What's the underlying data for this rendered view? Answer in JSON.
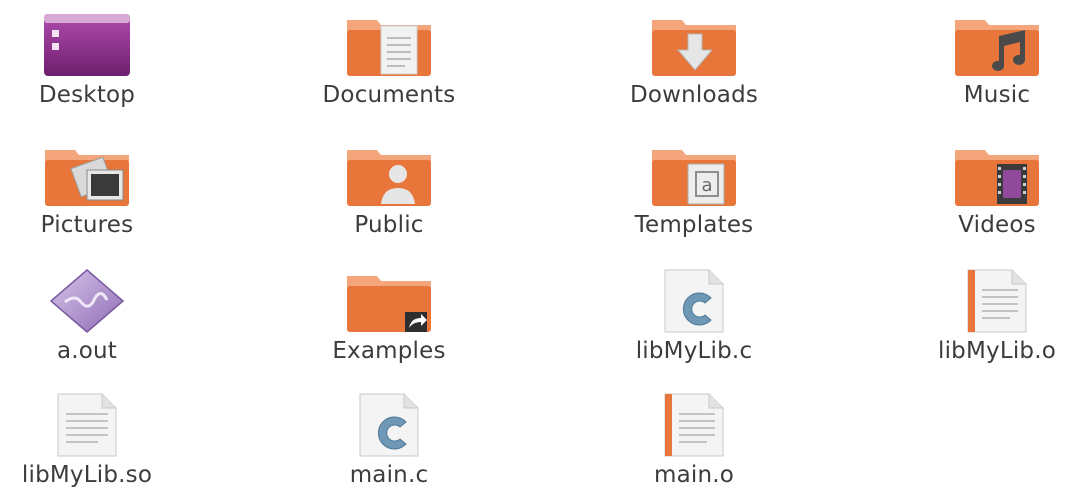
{
  "files": [
    {
      "label": "Desktop",
      "icon": "desktop-folder-icon"
    },
    {
      "label": "Documents",
      "icon": "documents-folder-icon"
    },
    {
      "label": "Downloads",
      "icon": "downloads-folder-icon"
    },
    {
      "label": "Music",
      "icon": "music-folder-icon"
    },
    {
      "label": "Pictures",
      "icon": "pictures-folder-icon"
    },
    {
      "label": "Public",
      "icon": "public-folder-icon"
    },
    {
      "label": "Templates",
      "icon": "templates-folder-icon"
    },
    {
      "label": "Videos",
      "icon": "videos-folder-icon"
    },
    {
      "label": "a.out",
      "icon": "executable-icon"
    },
    {
      "label": "Examples",
      "icon": "examples-folder-link-icon"
    },
    {
      "label": "libMyLib.c",
      "icon": "c-source-file-icon"
    },
    {
      "label": "libMyLib.o",
      "icon": "object-file-icon"
    },
    {
      "label": "libMyLib.so",
      "icon": "shared-library-file-icon"
    },
    {
      "label": "main.c",
      "icon": "c-source-file-icon"
    },
    {
      "label": "main.o",
      "icon": "object-file-icon"
    }
  ],
  "colors": {
    "folder_orange": "#e8763a",
    "folder_tab": "#f4a57c",
    "desktop_purple": "#8f2f8f",
    "text": "#3c3c3c"
  }
}
